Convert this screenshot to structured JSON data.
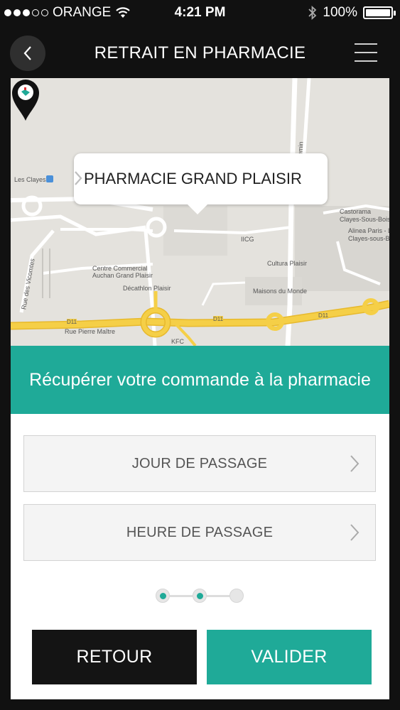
{
  "status_bar": {
    "carrier": "ORANGE",
    "time": "4:21 PM",
    "battery": "100%",
    "battery_level": 1.0,
    "signal_bars_filled": 3,
    "signal_bars_total": 5
  },
  "header": {
    "title": "RETRAIT EN PHARMACIE",
    "back_icon": "chevron-left-icon",
    "menu_icon": "hamburger-menu-icon"
  },
  "map": {
    "callout": "PHARMACIE GRAND PLAISIR",
    "labels": {
      "les_clayes": "Les Clayes",
      "castorama_1": "Castorama",
      "castorama_2": "Clayes-Sous-Bois",
      "alinea_1": "Alinea Paris - L",
      "alinea_2": "Clayes-sous-Bo",
      "iicg": "IICG",
      "cultura": "Cultura Plaisir",
      "centre_1": "Centre Commercial",
      "centre_2": "Auchan Grand Plaisir",
      "decathlon": "Décathlon Plaisir",
      "maisons": "Maisons du Monde",
      "rue_vicomtes": "Rue des Vicomtes",
      "rue_pierre": "Rue Pierre Maître",
      "kfc": "KFC",
      "chemin": "Chemin",
      "d11_a": "D11",
      "d11_b": "D11",
      "d11_c": "D11"
    }
  },
  "banner": "Récupérer votre commande à la pharmacie",
  "selectors": {
    "day": "JOUR DE PASSAGE",
    "hour": "HEURE DE PASSAGE"
  },
  "stepper": {
    "total": 3,
    "completed": 2
  },
  "buttons": {
    "back": "RETOUR",
    "confirm": "VALIDER"
  },
  "colors": {
    "accent": "#1faa98",
    "dark": "#141414",
    "road": "#f5cf47"
  }
}
